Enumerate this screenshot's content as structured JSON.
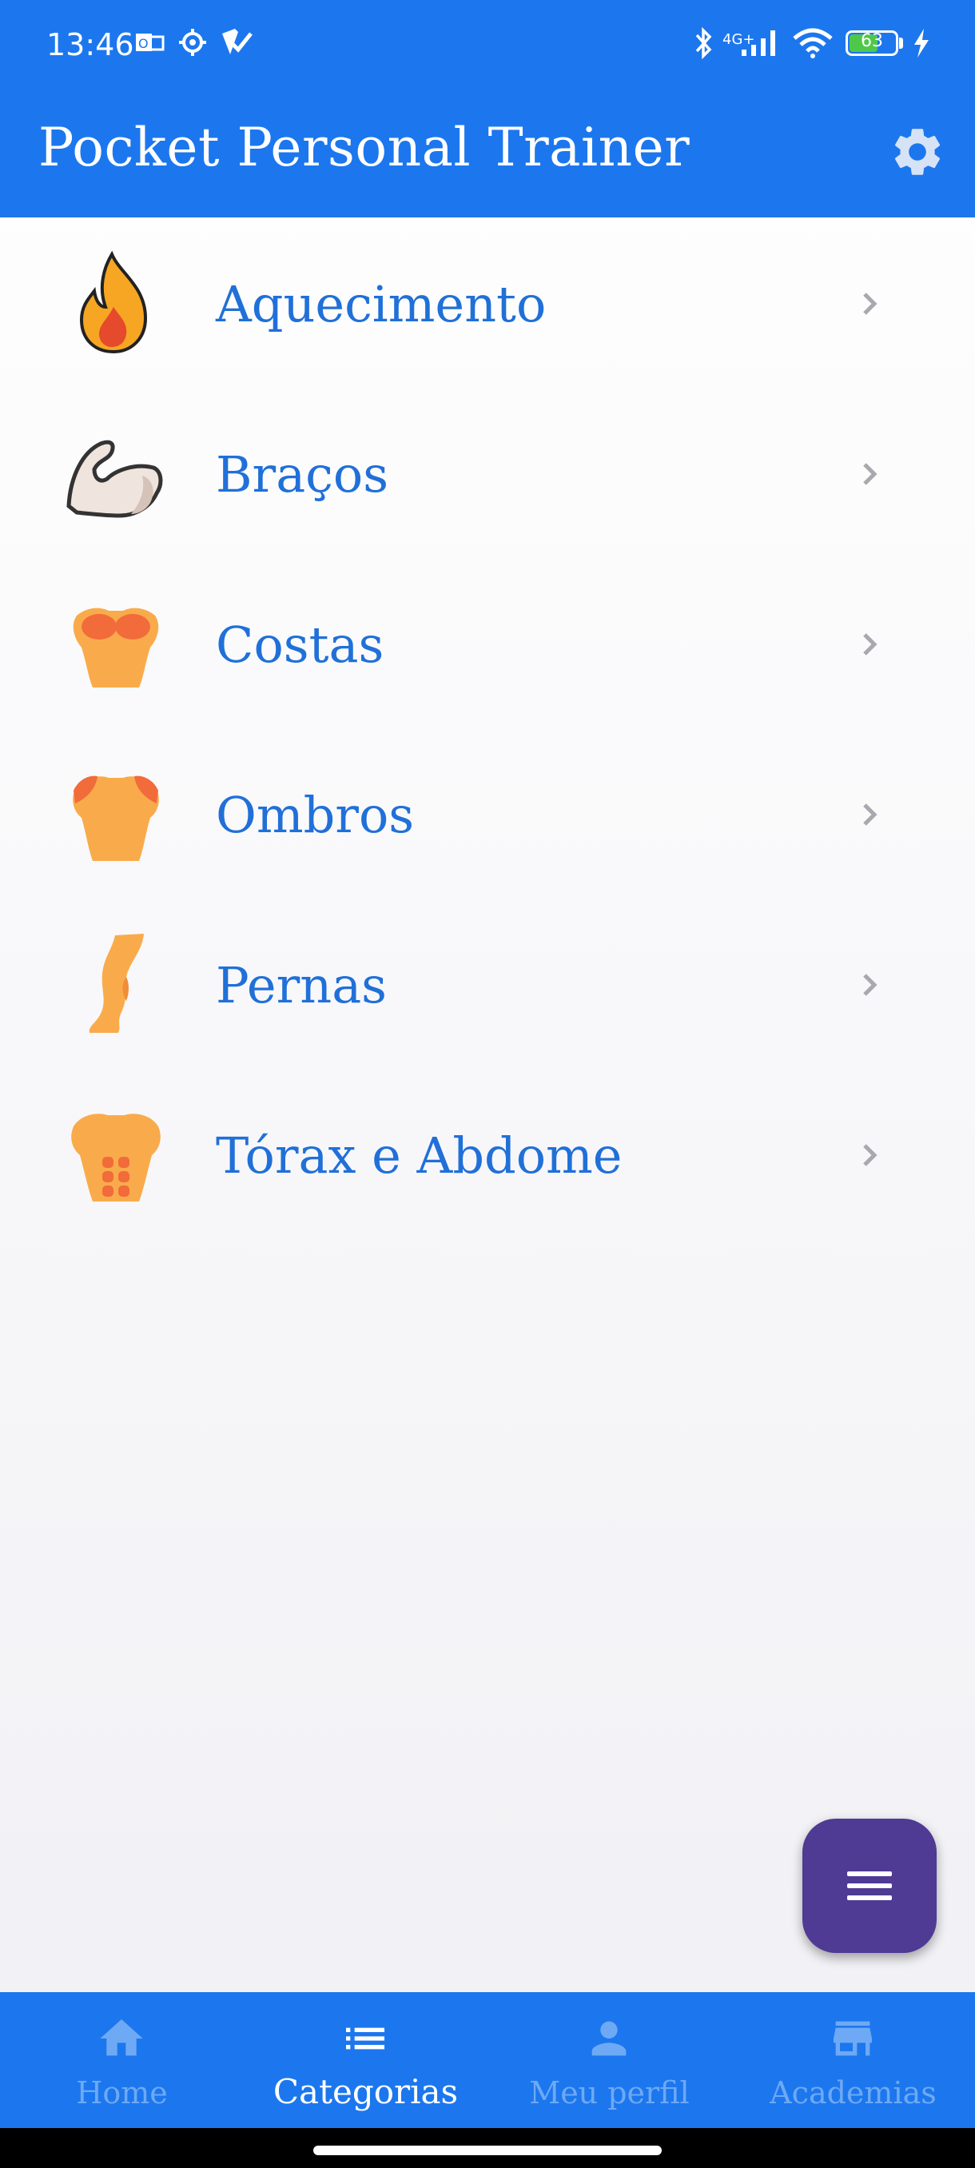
{
  "status_bar": {
    "time": "13:46",
    "network": "4G+",
    "battery_level": "63",
    "battery_fraction": 0.63
  },
  "app_bar": {
    "title": "Pocket Personal Trainer",
    "settings_icon": "gear-icon"
  },
  "categories": [
    {
      "label": "Aquecimento",
      "icon": "fire-icon"
    },
    {
      "label": "Braços",
      "icon": "flexed-biceps-icon"
    },
    {
      "label": "Costas",
      "icon": "back-muscles-icon"
    },
    {
      "label": "Ombros",
      "icon": "shoulders-icon"
    },
    {
      "label": "Pernas",
      "icon": "leg-icon"
    },
    {
      "label": "Tórax e Abdome",
      "icon": "torso-abs-icon"
    }
  ],
  "fab": {
    "icon": "menu-icon"
  },
  "bottom_nav": {
    "items": [
      {
        "label": "Home",
        "icon": "home-icon",
        "active": false
      },
      {
        "label": "Categorias",
        "icon": "list-icon",
        "active": true
      },
      {
        "label": "Meu perfil",
        "icon": "person-icon",
        "active": false
      },
      {
        "label": "Academias",
        "icon": "store-icon",
        "active": false
      }
    ]
  },
  "colors": {
    "primary": "#1c77ee",
    "label_blue": "#2070d8",
    "fab": "#4f3a94",
    "nav_inactive": "#6ea9f5"
  }
}
